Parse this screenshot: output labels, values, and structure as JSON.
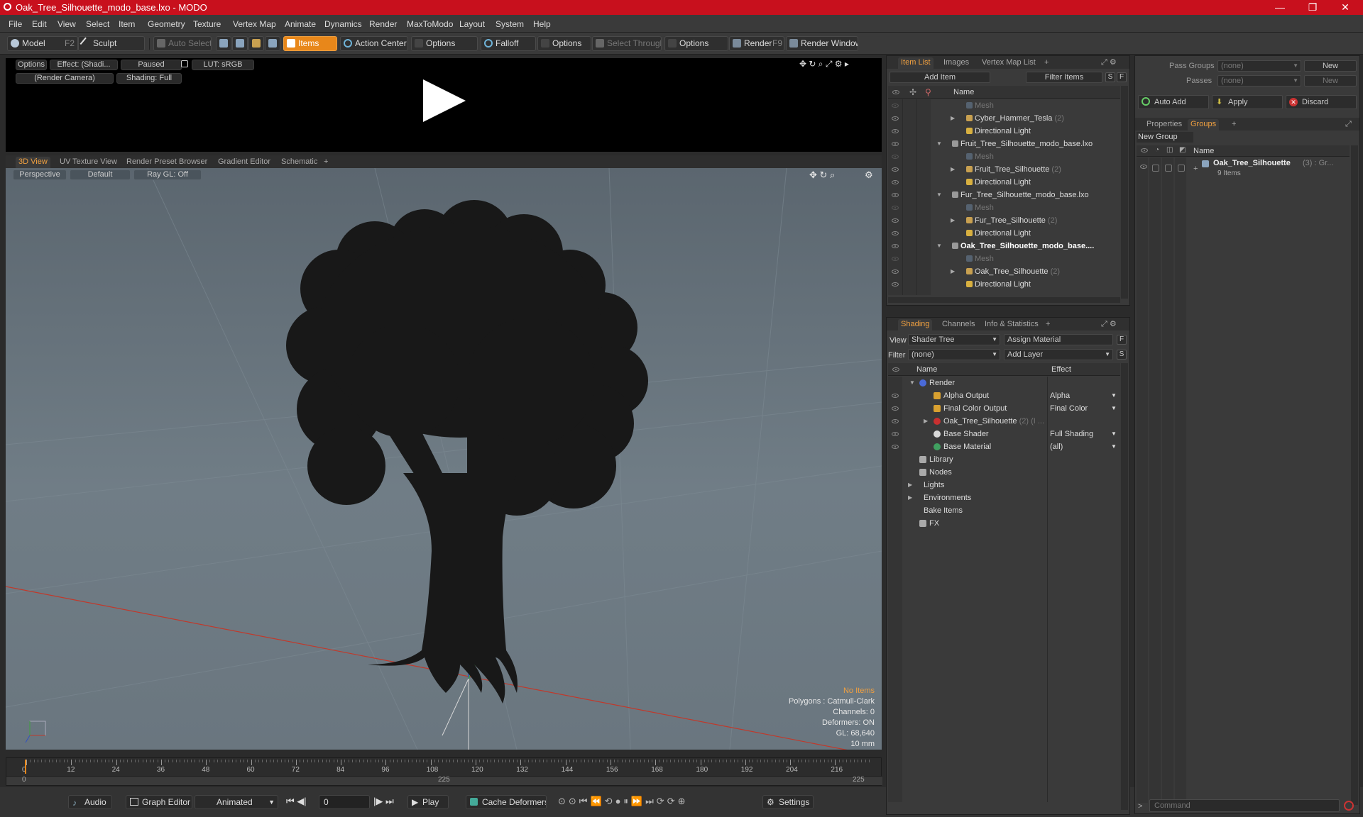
{
  "window": {
    "title": "Oak_Tree_Silhouette_modo_base.lxo - MODO"
  },
  "menu": [
    "File",
    "Edit",
    "View",
    "Select",
    "Item",
    "Geometry",
    "Texture",
    "Vertex Map",
    "Animate",
    "Dynamics",
    "Render",
    "MaxToModo",
    "Layout",
    "System",
    "Help"
  ],
  "toolbar": {
    "model": "Model",
    "model_key": "F2",
    "sculpt": "Sculpt",
    "auto_select": "Auto Select",
    "items": "Items",
    "action_center": "Action Center",
    "options1": "Options",
    "falloff": "Falloff",
    "options2": "Options",
    "select_through": "Select Through",
    "options3": "Options",
    "render": "Render",
    "render_key": "F9",
    "render_window": "Render Window"
  },
  "preview": {
    "options": "Options",
    "effect": "Effect: (Shadi...",
    "paused": "Paused",
    "lut": "LUT: sRGB",
    "camera": "(Render Camera)",
    "shading": "Shading: Full"
  },
  "view_tabs": [
    "3D View",
    "UV Texture View",
    "Render Preset Browser",
    "Gradient Editor",
    "Schematic"
  ],
  "viewport": {
    "perspective": "Perspective",
    "default": "Default",
    "raygl": "Ray GL: Off",
    "info": {
      "no_items": "No Items",
      "polygons": "Polygons : Catmull-Clark",
      "channels": "Channels: 0",
      "deformers": "Deformers: ON",
      "gl": "GL: 68,640",
      "mm": "10 mm"
    }
  },
  "timeline": {
    "ticks": [
      "0",
      "12",
      "24",
      "36",
      "48",
      "60",
      "72",
      "84",
      "96",
      "108",
      "120",
      "132",
      "144",
      "156",
      "168",
      "180",
      "192",
      "204",
      "216"
    ],
    "range_start": "0",
    "range_mid": "225",
    "range_end": "225"
  },
  "bottom": {
    "audio": "Audio",
    "graph_editor": "Graph Editor",
    "animated": "Animated",
    "frame": "0",
    "play": "Play",
    "cache_deformers": "Cache Deformers",
    "settings": "Settings"
  },
  "item_list": {
    "tabs": [
      "Item List",
      "Images",
      "Vertex Map List"
    ],
    "add_item": "Add Item",
    "filter_items": "Filter Items",
    "s": "S",
    "f": "F",
    "header_name": "Name",
    "rows": [
      {
        "label": "Mesh",
        "count": "",
        "indent": 3,
        "dim": true,
        "bold": false,
        "expand": ""
      },
      {
        "label": "Cyber_Hammer_Tesla",
        "count": "(2)",
        "indent": 3,
        "dim": false,
        "bold": false,
        "expand": "▶"
      },
      {
        "label": "Directional Light",
        "count": "",
        "indent": 3,
        "dim": false,
        "bold": false,
        "expand": ""
      },
      {
        "label": "Fruit_Tree_Silhouette_modo_base.lxo",
        "count": "",
        "indent": 2,
        "dim": false,
        "bold": false,
        "expand": "▼"
      },
      {
        "label": "Mesh",
        "count": "",
        "indent": 3,
        "dim": true,
        "bold": false,
        "expand": ""
      },
      {
        "label": "Fruit_Tree_Silhouette",
        "count": "(2)",
        "indent": 3,
        "dim": false,
        "bold": false,
        "expand": "▶"
      },
      {
        "label": "Directional Light",
        "count": "",
        "indent": 3,
        "dim": false,
        "bold": false,
        "expand": ""
      },
      {
        "label": "Fur_Tree_Silhouette_modo_base.lxo",
        "count": "",
        "indent": 2,
        "dim": false,
        "bold": false,
        "expand": "▼"
      },
      {
        "label": "Mesh",
        "count": "",
        "indent": 3,
        "dim": true,
        "bold": false,
        "expand": ""
      },
      {
        "label": "Fur_Tree_Silhouette",
        "count": "(2)",
        "indent": 3,
        "dim": false,
        "bold": false,
        "expand": "▶"
      },
      {
        "label": "Directional Light",
        "count": "",
        "indent": 3,
        "dim": false,
        "bold": false,
        "expand": ""
      },
      {
        "label": "Oak_Tree_Silhouette_modo_base....",
        "count": "",
        "indent": 2,
        "dim": false,
        "bold": true,
        "expand": "▼"
      },
      {
        "label": "Mesh",
        "count": "",
        "indent": 3,
        "dim": true,
        "bold": false,
        "expand": ""
      },
      {
        "label": "Oak_Tree_Silhouette",
        "count": "(2)",
        "indent": 3,
        "dim": false,
        "bold": false,
        "expand": "▶"
      },
      {
        "label": "Directional Light",
        "count": "",
        "indent": 3,
        "dim": false,
        "bold": false,
        "expand": ""
      }
    ]
  },
  "shading": {
    "tabs": [
      "Shading",
      "Channels",
      "Info & Statistics"
    ],
    "view_label": "View",
    "view_value": "Shader Tree",
    "assign_material": "Assign Material",
    "filter_label": "Filter",
    "filter_value": "(none)",
    "add_layer": "Add Layer",
    "f": "F",
    "s": "S",
    "col_name": "Name",
    "col_effect": "Effect",
    "rows": [
      {
        "label": "Render",
        "count": "",
        "effect": "",
        "indent": 0,
        "eye": false,
        "expand": "▼",
        "icon": "sphere"
      },
      {
        "label": "Alpha Output",
        "count": "",
        "effect": "Alpha",
        "indent": 1,
        "eye": true,
        "expand": "",
        "icon": "output"
      },
      {
        "label": "Final Color Output",
        "count": "",
        "effect": "Final Color",
        "indent": 1,
        "eye": true,
        "expand": "",
        "icon": "output"
      },
      {
        "label": "Oak_Tree_Silhouette",
        "count": "(2) (I ...",
        "effect": "",
        "indent": 1,
        "eye": true,
        "expand": "▶",
        "icon": "mask"
      },
      {
        "label": "Base Shader",
        "count": "",
        "effect": "Full Shading",
        "indent": 1,
        "eye": true,
        "expand": "",
        "icon": "shader"
      },
      {
        "label": "Base Material",
        "count": "",
        "effect": "(all)",
        "indent": 1,
        "eye": true,
        "expand": "",
        "icon": "material"
      },
      {
        "label": "Library",
        "count": "",
        "effect": "",
        "indent": 0,
        "eye": false,
        "expand": "",
        "icon": "folder"
      },
      {
        "label": "Nodes",
        "count": "",
        "effect": "",
        "indent": 0,
        "eye": false,
        "expand": "",
        "icon": "folder"
      },
      {
        "label": "Lights",
        "count": "",
        "effect": "",
        "indent": -1,
        "eye": false,
        "expand": "▶",
        "icon": ""
      },
      {
        "label": "Environments",
        "count": "",
        "effect": "",
        "indent": -1,
        "eye": false,
        "expand": "▶",
        "icon": ""
      },
      {
        "label": "Bake Items",
        "count": "",
        "effect": "",
        "indent": -1,
        "eye": false,
        "expand": "",
        "icon": ""
      },
      {
        "label": "FX",
        "count": "",
        "effect": "",
        "indent": 0,
        "eye": false,
        "expand": "",
        "icon": "fx"
      }
    ]
  },
  "groups": {
    "pass_groups_label": "Pass Groups",
    "pass_groups_value": "(none)",
    "new1": "New",
    "passes_label": "Passes",
    "passes_value": "(none)",
    "new2": "New",
    "auto_add": "Auto Add",
    "apply": "Apply",
    "discard": "Discard",
    "tabs": [
      "Properties",
      "Groups"
    ],
    "new_group": "New Group",
    "header_name": "Name",
    "group_name": "Oak_Tree_Silhouette",
    "group_count": "(3) : Gr...",
    "group_items": "9 Items"
  },
  "command": {
    "placeholder": "Command"
  },
  "colors": {
    "accent": "#f0a040",
    "titlebar": "#c8101d"
  }
}
